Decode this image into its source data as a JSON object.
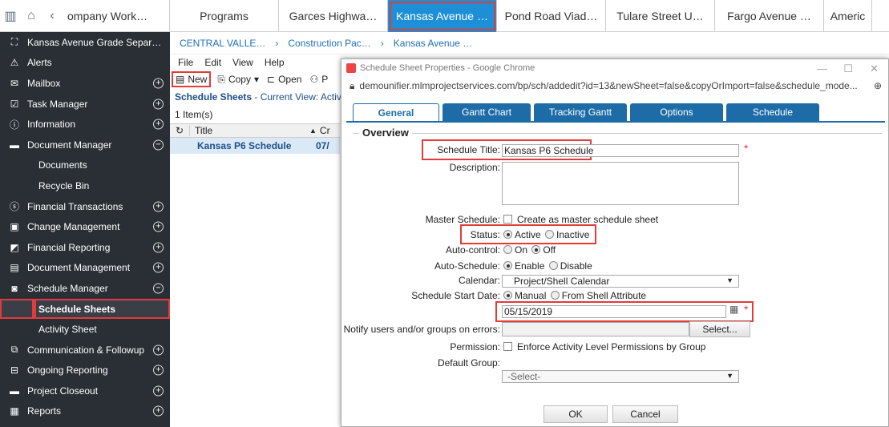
{
  "topbar": {
    "project_title": "ompany Work…",
    "tabs": [
      {
        "label": "Programs"
      },
      {
        "label": "Garces Highwa…"
      },
      {
        "label": "Kansas Avenue …"
      },
      {
        "label": "Pond Road Viad…"
      },
      {
        "label": "Tulare Street U…"
      },
      {
        "label": "Fargo Avenue …"
      },
      {
        "label": "Americ"
      }
    ]
  },
  "sidebar": {
    "project": "Kansas Avenue Grade Separ…",
    "items": [
      {
        "label": "Alerts",
        "icon": "warning-icon"
      },
      {
        "label": "Mailbox",
        "icon": "mail-icon"
      },
      {
        "label": "Task Manager",
        "icon": "check-icon"
      },
      {
        "label": "Information",
        "icon": "info-icon"
      },
      {
        "label": "Document Manager",
        "icon": "folder-icon"
      },
      {
        "label": "Documents"
      },
      {
        "label": "Recycle Bin"
      },
      {
        "label": "Financial Transactions",
        "icon": "dollar-icon"
      },
      {
        "label": "Change Management",
        "icon": "change-icon"
      },
      {
        "label": "Financial Reporting",
        "icon": "report-icon"
      },
      {
        "label": "Document Management",
        "icon": "docs-icon"
      },
      {
        "label": "Schedule Manager",
        "icon": "schedule-icon"
      },
      {
        "label": "Schedule Sheets"
      },
      {
        "label": "Activity Sheet"
      },
      {
        "label": "Communication & Followup",
        "icon": "comm-icon"
      },
      {
        "label": "Ongoing Reporting",
        "icon": "ongoing-icon"
      },
      {
        "label": "Project Closeout",
        "icon": "folder-icon"
      },
      {
        "label": "Reports",
        "icon": "reports-icon"
      }
    ]
  },
  "main": {
    "breadcrumbs": [
      "CENTRAL VALLE…",
      "Construction Pac…",
      "Kansas Avenue …"
    ],
    "menu": [
      "File",
      "Edit",
      "View",
      "Help"
    ],
    "toolbar": {
      "new": "New",
      "copy": "Copy",
      "open": "Open",
      "p": "P"
    },
    "view_title": "Schedule Sheets",
    "view_suffix": "- Current View: Active",
    "count": "1 Item(s)",
    "col_title": "Title",
    "col_cr": "Cr",
    "row_title": "Kansas P6 Schedule",
    "row_date": "07/"
  },
  "dialog": {
    "window_title": "Schedule Sheet Properties - Google Chrome",
    "url": "demounifier.mlmprojectservices.com/bp/sch/addedit?id=13&newSheet=false&copyOrImport=false&schedule_mode...",
    "tabs": [
      "General",
      "Gantt Chart",
      "Tracking Gantt",
      "Options",
      "Schedule"
    ],
    "section": "Overview",
    "labels": {
      "schedule_title": "Schedule Title:",
      "description": "Description:",
      "master": "Master Schedule:",
      "status": "Status:",
      "auto_control": "Auto-control:",
      "auto_schedule": "Auto-Schedule:",
      "calendar": "Calendar:",
      "start_date": "Schedule Start Date:",
      "notify": "Notify users and/or groups on errors:",
      "permission": "Permission:",
      "default_group": "Default Group:"
    },
    "values": {
      "schedule_title": "Kansas P6 Schedule",
      "master_option": "Create as master schedule sheet",
      "status_active": "Active",
      "status_inactive": "Inactive",
      "auto_on": "On",
      "auto_off": "Off",
      "enable": "Enable",
      "disable": "Disable",
      "calendar": "Project/Shell Calendar",
      "manual": "Manual",
      "from_shell": "From Shell Attribute",
      "date": "05/15/2019",
      "select_btn": "Select...",
      "permission_option": "Enforce Activity Level Permissions by Group",
      "default_group": "-Select-"
    },
    "ok": "OK",
    "cancel": "Cancel"
  },
  "colors": {
    "accent": "#1d8fd6",
    "highlight": "#e23b3b",
    "sidebar": "#2a2e35"
  }
}
